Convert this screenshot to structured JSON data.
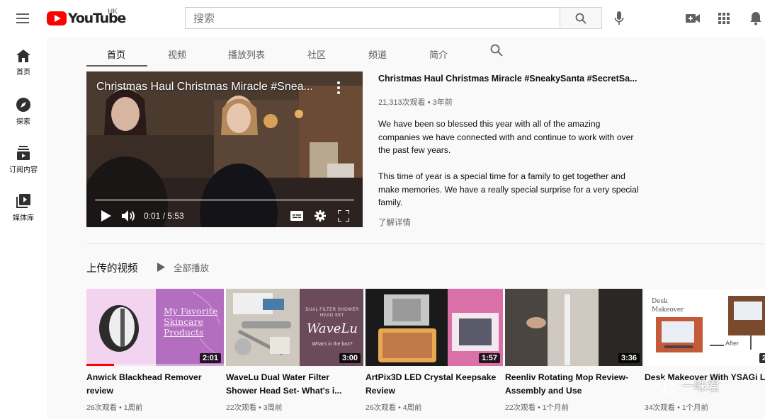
{
  "header": {
    "logo_text": "YouTube",
    "region": "HK",
    "search_placeholder": "搜索",
    "icons": [
      "menu-icon",
      "search-icon",
      "mic-icon",
      "create-video-icon",
      "apps-grid-icon",
      "notification-bell-icon"
    ]
  },
  "sidebar": {
    "items": [
      {
        "label": "首页",
        "icon": "home-icon"
      },
      {
        "label": "探索",
        "icon": "compass-icon"
      },
      {
        "label": "订阅内容",
        "icon": "subscriptions-icon"
      },
      {
        "label": "媒体库",
        "icon": "library-icon"
      }
    ]
  },
  "tabs": [
    {
      "label": "首页"
    },
    {
      "label": "视频"
    },
    {
      "label": "播放列表"
    },
    {
      "label": "社区"
    },
    {
      "label": "频道"
    },
    {
      "label": "简介"
    }
  ],
  "featured": {
    "player_title": "Christmas Haul Christmas Miracle #Snea...",
    "time": "0:01 / 5:53",
    "progress": 0.003,
    "title": "Christmas Haul Christmas Miracle #SneakySanta #SecretSa...",
    "meta": "21,313次观看 • 3年前",
    "desc1": "We have been so blessed this year with all of the amazing companies we have connected with and continue to work with over the past few years.",
    "desc2": "This time of year is a special time for a family to get together and make memories. We have a really special surprise for a very special family.",
    "more": "了解详情"
  },
  "shelf": {
    "title": "上传的视频",
    "play_all": "全部播放",
    "videos": [
      {
        "title": "Anwick Blackhead Remover review",
        "meta": "26次观看 • 1周前",
        "duration": "2:01",
        "thumb_text": "My Favorite Skincare Products",
        "watched": 0.2
      },
      {
        "title": "WaveLu Dual Water Filter Shower Head Set- What's i...",
        "meta": "22次观看 • 3周前",
        "duration": "3:00",
        "thumb_text": "WaveLu",
        "thumb_sub": "What's in the box?",
        "thumb_top": "DUAL FILTER SHOWER HEAD SET"
      },
      {
        "title": "ArtPix3D LED Crystal Keepsake Review",
        "meta": "26次观看 • 4周前",
        "duration": "1:57"
      },
      {
        "title": "Reenliv Rotating Mop Review- Assembly and Use",
        "meta": "22次观看 • 1个月前",
        "duration": "3:36"
      },
      {
        "title": "Desk Makeover With YSAGi Large Led Desk Pad",
        "meta": "34次观看 • 1个月前",
        "duration": "2",
        "thumb_text": "Desk Makeover",
        "thumb_after": "After"
      }
    ]
  },
  "watermark": "一味君"
}
